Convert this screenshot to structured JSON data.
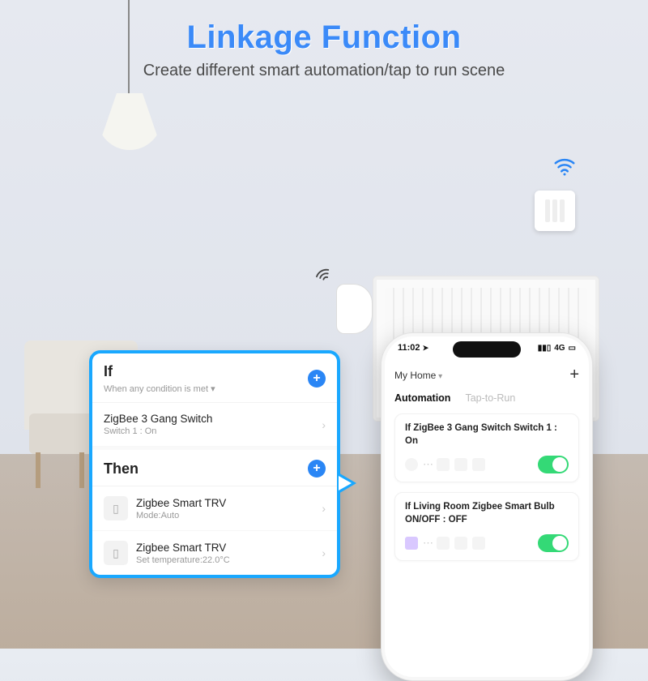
{
  "headline": "Linkage Function",
  "subhead": "Create different smart automation/tap to run scene",
  "callout": {
    "if_label": "If",
    "if_sub": "When any condition is met ▾",
    "if_item": {
      "title": "ZigBee 3 Gang Switch",
      "sub": "Switch 1 : On"
    },
    "then_label": "Then",
    "then_items": [
      {
        "title": "Zigbee Smart TRV",
        "sub": "Mode:Auto"
      },
      {
        "title": "Zigbee Smart TRV",
        "sub": "Set temperature:22.0°C"
      }
    ]
  },
  "phone": {
    "time": "11:02",
    "net": "4G",
    "home": "My Home",
    "tabs": {
      "active": "Automation",
      "inactive": "Tap-to-Run"
    },
    "cards": [
      {
        "title": "If ZigBee 3 Gang Switch Switch 1 : On"
      },
      {
        "title": "If  Living Room Zigbee Smart Bulb ON/OFF : OFF"
      }
    ]
  },
  "icons": {
    "plus": "+",
    "chevron": "›",
    "arrow": "→",
    "dots": "⋯",
    "signal": "▮▮▯",
    "battery": "▭",
    "loc": "➤"
  }
}
